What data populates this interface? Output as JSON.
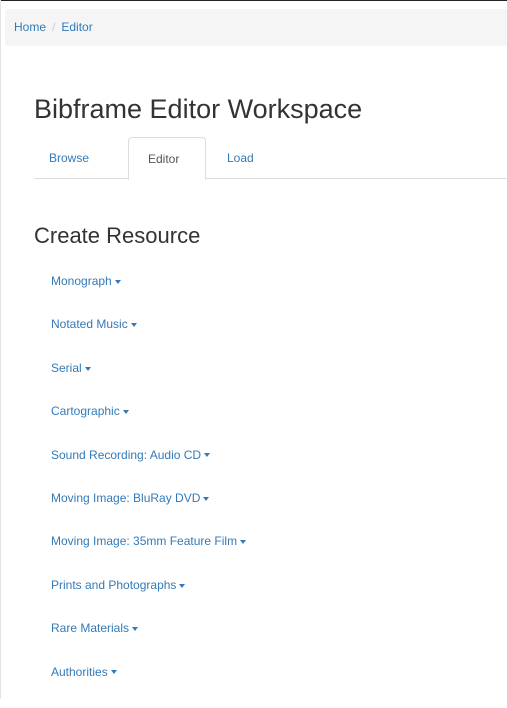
{
  "breadcrumb": {
    "home": "Home",
    "separator": "/",
    "current": "Editor"
  },
  "page": {
    "title": "Bibframe Editor Workspace"
  },
  "tabs": [
    {
      "label": "Browse",
      "active": false
    },
    {
      "label": "Editor",
      "active": true
    },
    {
      "label": "Load",
      "active": false
    }
  ],
  "create_resource": {
    "heading": "Create Resource",
    "items": [
      {
        "label": "Monograph"
      },
      {
        "label": "Notated Music"
      },
      {
        "label": "Serial"
      },
      {
        "label": "Cartographic"
      },
      {
        "label": "Sound Recording: Audio CD"
      },
      {
        "label": "Moving Image: BluRay DVD"
      },
      {
        "label": "Moving Image: 35mm Feature Film"
      },
      {
        "label": "Prints and Photographs"
      },
      {
        "label": "Rare Materials"
      },
      {
        "label": "Authorities"
      }
    ]
  },
  "colors": {
    "link": "#337ab7",
    "breadcrumb_bg": "#f5f5f5",
    "tab_border": "#dddddd"
  },
  "icons": {
    "dropdown": "caret-down-icon"
  }
}
